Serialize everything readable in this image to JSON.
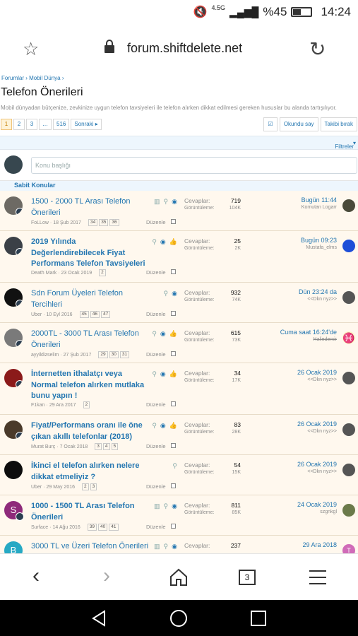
{
  "status": {
    "signal_label": "4.5G",
    "battery": "%45",
    "time": "14:24"
  },
  "browser": {
    "url": "forum.shiftdelete.net"
  },
  "breadcrumb": {
    "item1": "Forumlar",
    "item2": "Mobil Dünya"
  },
  "page": {
    "title": "Telefon Önerileri",
    "description": "Mobil dünyadan bütçenize, zevkinize uygun telefon tavsiyeleri ile telefon alırken dikkat edilmesi gereken hususlar bu alanda tartışılıyor."
  },
  "pager": {
    "p1": "1",
    "p2": "2",
    "p3": "3",
    "ellipsis": "…",
    "last": "516",
    "next": "Sonraki"
  },
  "actions": {
    "mark_read": "Okundu say",
    "watch": "Takibi bırak"
  },
  "filters": {
    "label": "Filtreler"
  },
  "new_thread": {
    "placeholder": "Konu başlığı"
  },
  "section": {
    "sticky": "Sabit Konular"
  },
  "labels": {
    "replies": "Cevaplar:",
    "views": "Görüntüleme:",
    "edit": "Düzenle"
  },
  "threads": [
    {
      "title": "1500 - 2000 TL Arası Telefon Önerileri",
      "author": "FoLLow",
      "date": "18 Şub 2017",
      "pages": [
        "34",
        "35",
        "36"
      ],
      "replies": "719",
      "views": "104K",
      "last_date": "Bugün 11:44",
      "last_user": "Komutan Logarr"
    },
    {
      "title": "2019 Yılında Değerlendirebilecek Fiyat Performans Telefon Tavsiyeleri",
      "author": "Death Mark",
      "date": "23 Ocak 2019",
      "pages": [
        "2"
      ],
      "replies": "25",
      "views": "2K",
      "last_date": "Bugün 09:23",
      "last_user": "Mustafa_elms"
    },
    {
      "title": "Sdn Forum Üyeleri Telefon Tercihleri",
      "author": "Uber",
      "date": "10 Eyl 2016",
      "pages": [
        "45",
        "46",
        "47"
      ],
      "replies": "932",
      "views": "74K",
      "last_date": "Dün 23:24 da",
      "last_user": "<<Dkn nyz>>"
    },
    {
      "title": "2000TL - 3000 TL Arası Telefon Önerileri",
      "author": "ayyildizselim",
      "date": "27 Şub 2017",
      "pages": [
        "29",
        "30",
        "31"
      ],
      "replies": "615",
      "views": "73K",
      "last_date": "Cuma saat 16:24'de",
      "last_user": "Haliedemir"
    },
    {
      "title": "İnternetten ithalatçı veya Normal telefon alırken mutlaka bunu yapın !",
      "author": "F1kan",
      "date": "29 Ara 2017",
      "pages": [
        "2"
      ],
      "replies": "34",
      "views": "17K",
      "last_date": "26 Ocak 2019",
      "last_user": "<<Dkn nyz>>"
    },
    {
      "title": "Fiyat/Performans oranı ile öne çıkan akıllı telefonlar (2018)",
      "author": "Murat Burç",
      "date": "7 Ocak 2018",
      "pages": [
        "3",
        "4",
        "5"
      ],
      "replies": "83",
      "views": "28K",
      "last_date": "26 Ocak 2019",
      "last_user": "<<Dkn nyz>>"
    },
    {
      "title": "İkinci el telefon alırken nelere dikkat etmeliyiz ?",
      "author": "Uber",
      "date": "29 May 2016",
      "pages": [
        "2",
        "3"
      ],
      "replies": "54",
      "views": "15K",
      "last_date": "26 Ocak 2019",
      "last_user": "<<Dkn nyz>>"
    },
    {
      "title": "1000 - 1500 TL Arası Telefon Önerileri",
      "author": "Surface",
      "date": "14 Ağu 2016",
      "pages": [
        "39",
        "40",
        "41"
      ],
      "replies": "811",
      "views": "85K",
      "last_date": "24 Ocak 2019",
      "last_user": "szgnkgl"
    },
    {
      "title": "3000 TL ve Üzeri Telefon Önerileri",
      "author": "",
      "date": "",
      "pages": [],
      "replies": "237",
      "views": "",
      "last_date": "29 Ara 2018",
      "last_user": ""
    }
  ],
  "avatar_letters": {
    "surface": "S",
    "row9": "B",
    "row9_last": "T"
  },
  "colors": {
    "link": "#2577b1",
    "sticky_bg": "#fff8ee",
    "accent_bg": "#edf6fd"
  }
}
